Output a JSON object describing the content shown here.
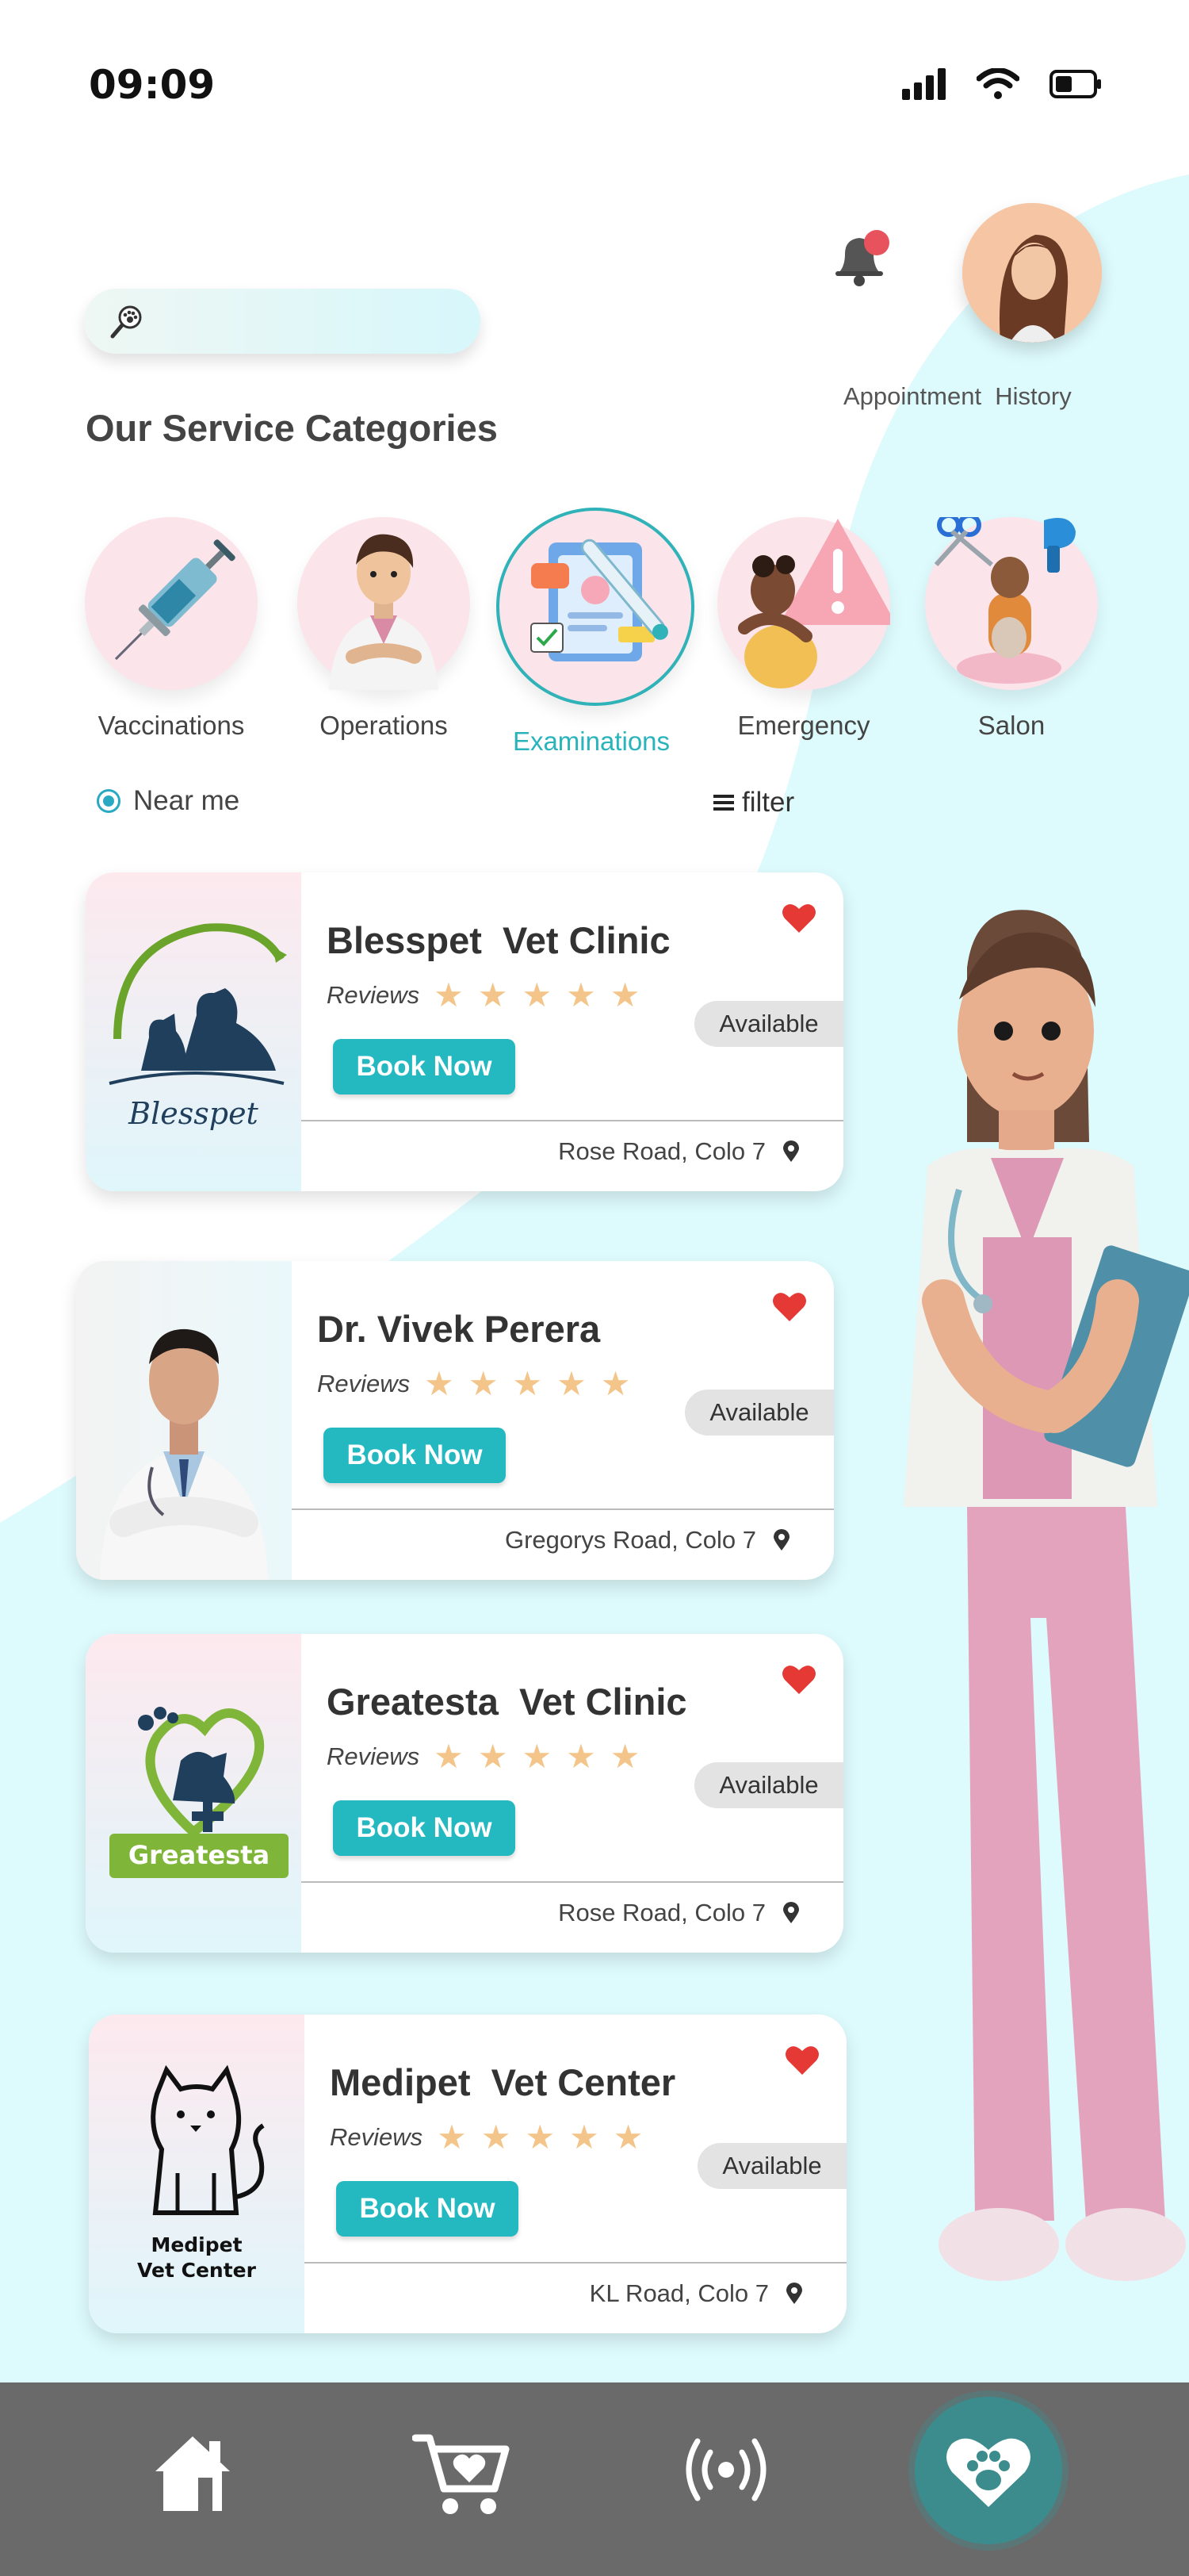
{
  "status_bar": {
    "time": "09:09",
    "signal_icon": "signal-bars-icon",
    "wifi_icon": "wifi-icon",
    "battery_icon": "battery-icon"
  },
  "search": {
    "placeholder": "",
    "icon": "paw-search-icon"
  },
  "header": {
    "notification_icon": "bell-icon",
    "avatar": "user-avatar",
    "appointment_history_label": "Appointment  History"
  },
  "section_title": "Our Service Categories",
  "categories": [
    {
      "label": "Vaccinations",
      "icon": "syringe-icon"
    },
    {
      "label": "Operations",
      "icon": "surgeon-icon"
    },
    {
      "label": "Examinations",
      "icon": "clipboard-thermometer-icon"
    },
    {
      "label": "Emergency",
      "icon": "warning-icon"
    },
    {
      "label": "Salon",
      "icon": "scissors-dryer-icon"
    }
  ],
  "active_category": "Examinations",
  "filters": {
    "near_me_label": "Near me",
    "filter_label": "filter"
  },
  "listings": [
    {
      "name": "Blesspet  Vet Clinic",
      "reviews_label": "Reviews",
      "rating": 5,
      "book_label": "Book Now",
      "status": "Available",
      "location": "Rose Road, Colo 7",
      "logo_text": "Blesspet"
    },
    {
      "name": "Dr. Vivek Perera",
      "reviews_label": "Reviews",
      "rating": 5,
      "book_label": "Book Now",
      "status": "Available",
      "location": "Gregorys Road, Colo 7",
      "logo_text": ""
    },
    {
      "name": "Greatesta  Vet Clinic",
      "reviews_label": "Reviews",
      "rating": 5,
      "book_label": "Book Now",
      "status": "Available",
      "location": "Rose Road, Colo 7",
      "logo_text": "Greatesta"
    },
    {
      "name": "Medipet  Vet Center",
      "reviews_label": "Reviews",
      "rating": 5,
      "book_label": "Book Now",
      "status": "Available",
      "location": "KL Road, Colo 7",
      "logo_text_line1": "Medipet",
      "logo_text_line2": "Vet Center"
    }
  ],
  "bottom_nav": [
    {
      "icon": "home-icon"
    },
    {
      "icon": "cart-heart-icon"
    },
    {
      "icon": "broadcast-icon"
    },
    {
      "icon": "paw-heart-icon",
      "active": true
    }
  ],
  "colors": {
    "accent": "#24b8c0",
    "heart": "#e53935",
    "star": "#f4c58a",
    "nav_bg": "#6a6a6a",
    "bg_shape": "#ddfafc"
  }
}
